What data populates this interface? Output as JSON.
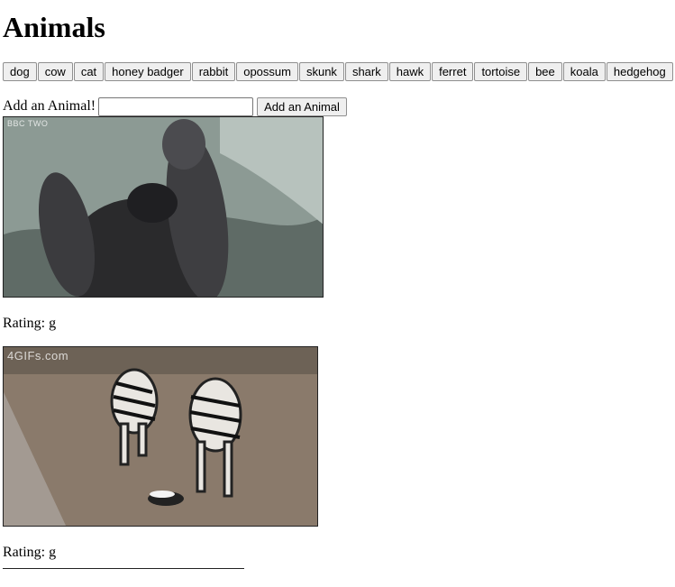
{
  "page": {
    "title": "Animals"
  },
  "animal_buttons": [
    "dog",
    "cow",
    "cat",
    "honey badger",
    "rabbit",
    "opossum",
    "skunk",
    "shark",
    "hawk",
    "ferret",
    "tortoise",
    "bee",
    "koala",
    "hedgehog"
  ],
  "add_form": {
    "label": "Add an Animal!",
    "input_value": "",
    "button_label": "Add an Animal"
  },
  "gifs": [
    {
      "watermark": "BBC TWO",
      "rating_label": "Rating: g",
      "depicts": "honey-badger-image"
    },
    {
      "watermark": "4GIFs.com",
      "rating_label": "Rating: g",
      "depicts": "zebras-honey-badger-image"
    }
  ],
  "colors": {
    "button_bg": "#efefef",
    "button_border": "#8f8f8f"
  }
}
